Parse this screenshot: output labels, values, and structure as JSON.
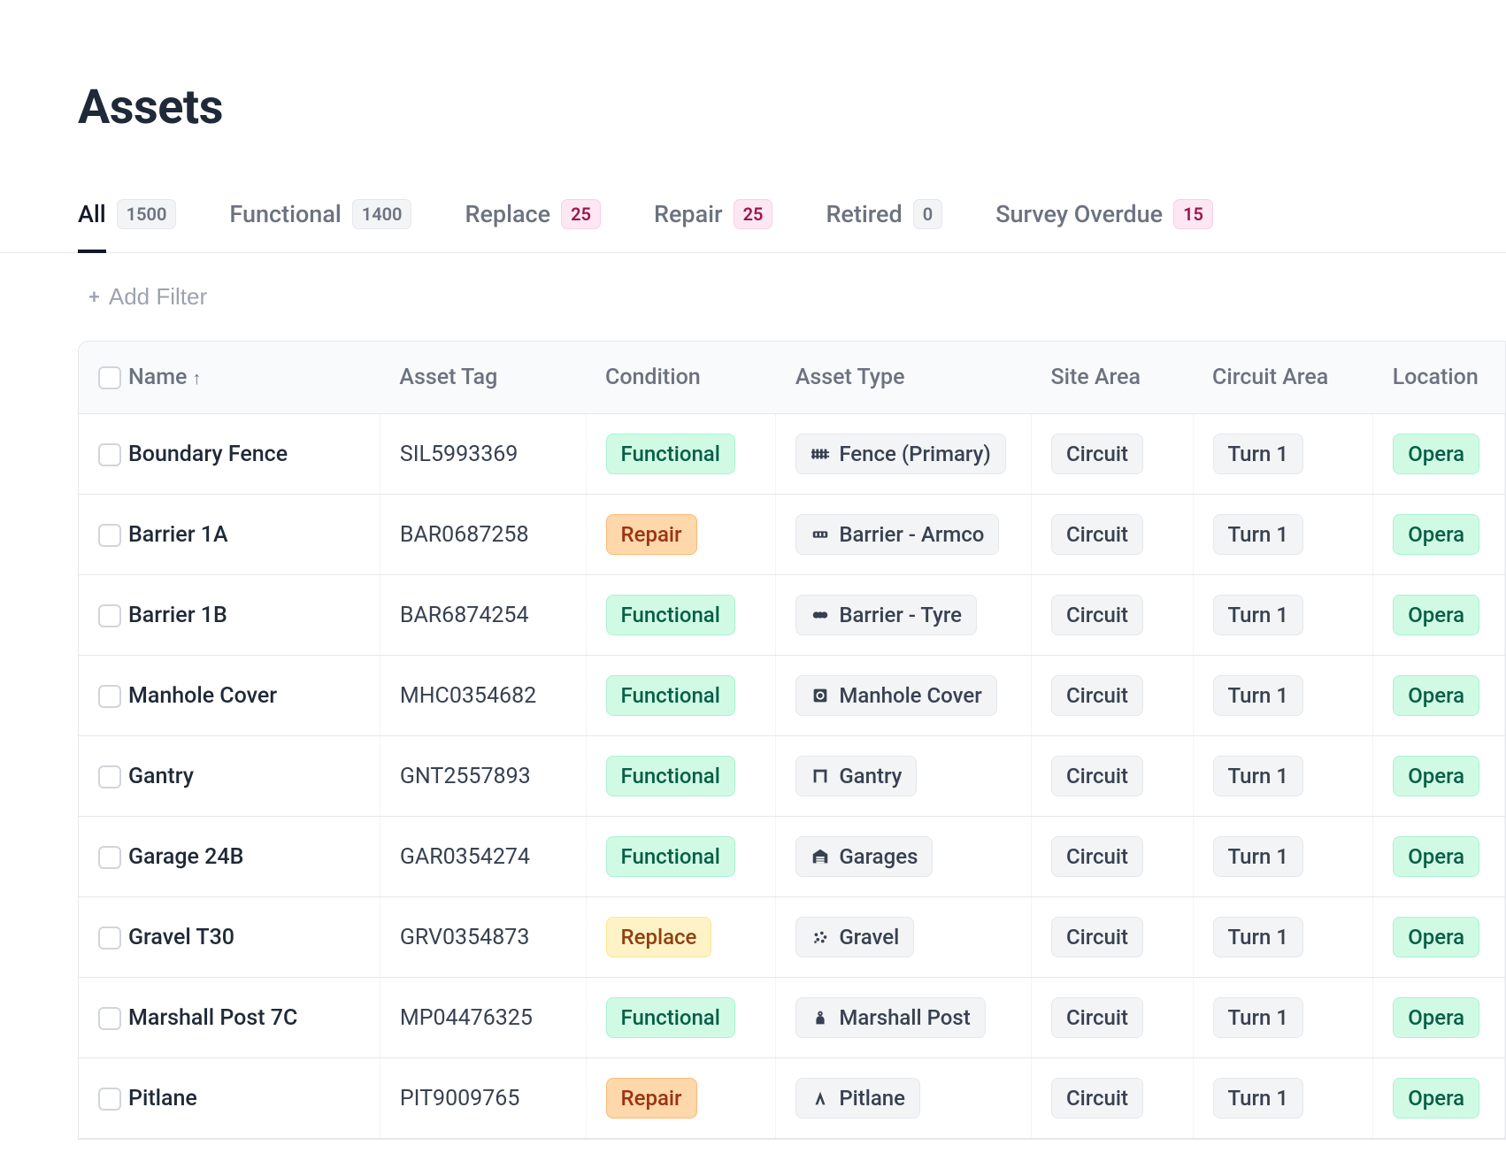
{
  "page": {
    "title": "Assets"
  },
  "tabs": [
    {
      "label": "All",
      "count": "1500",
      "active": true,
      "badge_style": "grey"
    },
    {
      "label": "Functional",
      "count": "1400",
      "active": false,
      "badge_style": "grey"
    },
    {
      "label": "Replace",
      "count": "25",
      "active": false,
      "badge_style": "pink"
    },
    {
      "label": "Repair",
      "count": "25",
      "active": false,
      "badge_style": "pink"
    },
    {
      "label": "Retired",
      "count": "0",
      "active": false,
      "badge_style": "grey"
    },
    {
      "label": "Survey Overdue",
      "count": "15",
      "active": false,
      "badge_style": "pink"
    }
  ],
  "filter": {
    "add_filter_label": "Add Filter"
  },
  "table": {
    "columns": [
      {
        "label": "Name",
        "sortable": true,
        "sort_dir": "asc"
      },
      {
        "label": "Asset Tag"
      },
      {
        "label": "Condition"
      },
      {
        "label": "Asset Type"
      },
      {
        "label": "Site Area"
      },
      {
        "label": "Circuit Area"
      },
      {
        "label": "Location"
      }
    ],
    "rows": [
      {
        "name": "Boundary Fence",
        "tag": "SIL5993369",
        "condition": "Functional",
        "type": "Fence (Primary)",
        "type_icon": "fence",
        "site": "Circuit",
        "circuit": "Turn 1",
        "location": "Opera"
      },
      {
        "name": "Barrier 1A",
        "tag": "BAR0687258",
        "condition": "Repair",
        "type": "Barrier - Armco",
        "type_icon": "barrier-armco",
        "site": "Circuit",
        "circuit": "Turn 1",
        "location": "Opera"
      },
      {
        "name": "Barrier 1B",
        "tag": "BAR6874254",
        "condition": "Functional",
        "type": "Barrier - Tyre",
        "type_icon": "barrier-tyre",
        "site": "Circuit",
        "circuit": "Turn 1",
        "location": "Opera"
      },
      {
        "name": "Manhole Cover",
        "tag": "MHC0354682",
        "condition": "Functional",
        "type": "Manhole Cover",
        "type_icon": "manhole",
        "site": "Circuit",
        "circuit": "Turn 1",
        "location": "Opera"
      },
      {
        "name": "Gantry",
        "tag": "GNT2557893",
        "condition": "Functional",
        "type": "Gantry",
        "type_icon": "gantry",
        "site": "Circuit",
        "circuit": "Turn 1",
        "location": "Opera"
      },
      {
        "name": "Garage 24B",
        "tag": "GAR0354274",
        "condition": "Functional",
        "type": "Garages",
        "type_icon": "garage",
        "site": "Circuit",
        "circuit": "Turn 1",
        "location": "Opera"
      },
      {
        "name": "Gravel T30",
        "tag": "GRV0354873",
        "condition": "Replace",
        "type": "Gravel",
        "type_icon": "gravel",
        "site": "Circuit",
        "circuit": "Turn 1",
        "location": "Opera"
      },
      {
        "name": "Marshall Post 7C",
        "tag": "MP04476325",
        "condition": "Functional",
        "type": "Marshall Post",
        "type_icon": "marshall",
        "site": "Circuit",
        "circuit": "Turn 1",
        "location": "Opera"
      },
      {
        "name": "Pitlane",
        "tag": "PIT9009765",
        "condition": "Repair",
        "type": "Pitlane",
        "type_icon": "pitlane",
        "site": "Circuit",
        "circuit": "Turn 1",
        "location": "Opera"
      }
    ]
  }
}
